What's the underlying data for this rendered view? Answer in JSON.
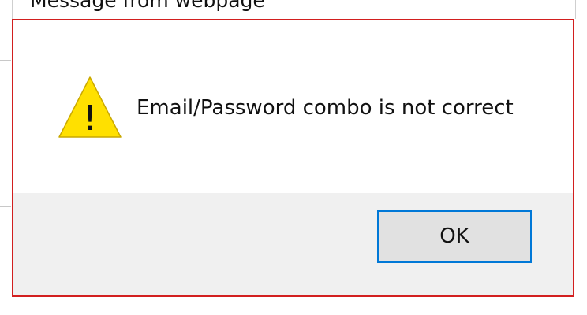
{
  "window": {
    "title": "Message from webpage"
  },
  "dialog": {
    "icon": "warning-icon",
    "icon_glyph": "!",
    "message": "Email/Password combo is not correct",
    "ok_label": "OK"
  },
  "colors": {
    "border_accent": "#d21f1f",
    "button_focus": "#0078d7",
    "warning_fill": "#ffe000",
    "footer_bg": "#f0f0f0"
  }
}
